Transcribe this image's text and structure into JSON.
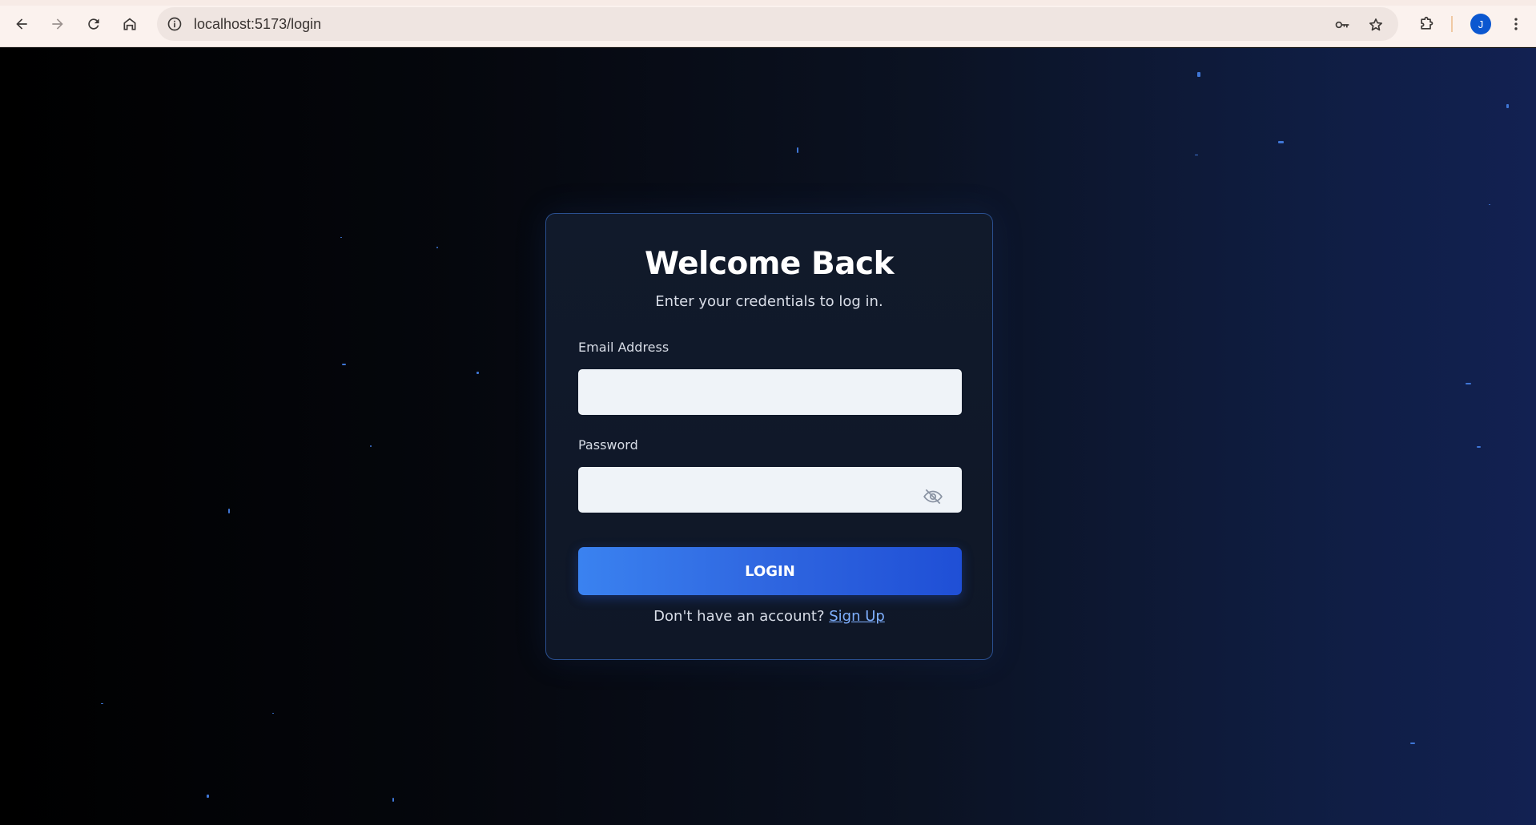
{
  "browser": {
    "url": "localhost:5173/login",
    "profile_initial": "J",
    "icons": [
      "back-icon",
      "forward-icon",
      "reload-icon",
      "home-icon",
      "site-info-icon",
      "password-key-icon",
      "bookmark-star-icon",
      "extensions-icon",
      "menu-kebab-icon"
    ]
  },
  "login": {
    "title": "Welcome Back",
    "subtitle": "Enter your credentials to log in.",
    "email_label": "Email Address",
    "email_value": "",
    "password_label": "Password",
    "password_value": "",
    "login_button": "LOGIN",
    "footer_prompt": "Don't have an account?",
    "signup_link": "Sign Up"
  },
  "colors": {
    "accent": "#2f66e0",
    "link": "#7fb0ff",
    "card_border": "#2a4f8f",
    "avatar": "#0b57d0"
  }
}
